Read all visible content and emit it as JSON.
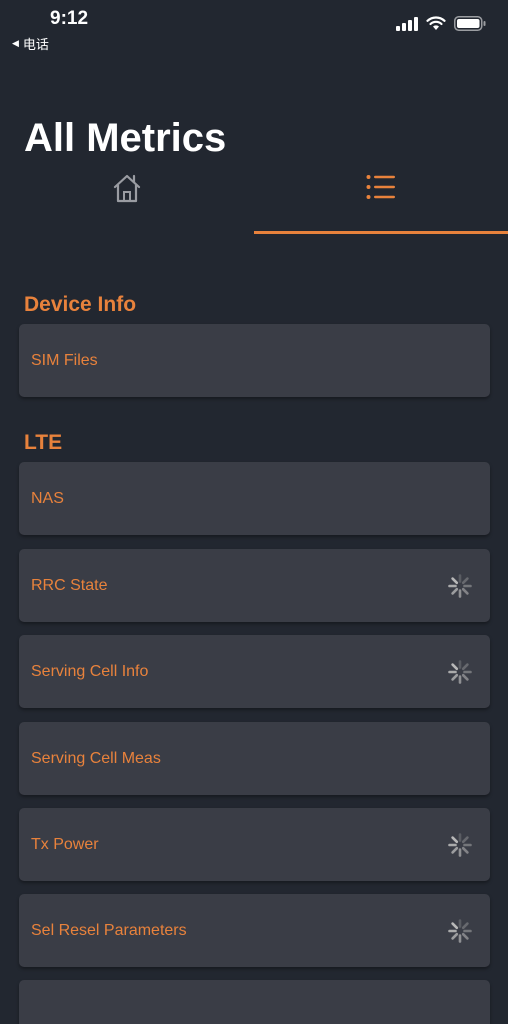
{
  "status_bar": {
    "time": "9:12",
    "back_app": "电话",
    "back_glyph": "◀",
    "icons": [
      "cellular-signal-icon",
      "wifi-icon",
      "battery-icon"
    ]
  },
  "header": {
    "title": "All Metrics"
  },
  "tabs": [
    {
      "icon": "home-icon",
      "selected": false
    },
    {
      "icon": "list-icon",
      "selected": true
    }
  ],
  "colors": {
    "accent": "#e8823c",
    "background": "#222730",
    "row_background": "#3a3d46",
    "spinner": "#b8b8b8"
  },
  "sections": [
    {
      "title": "Device Info",
      "items": [
        {
          "label": "SIM Files",
          "loading": false
        }
      ]
    },
    {
      "title": "LTE",
      "items": [
        {
          "label": "NAS",
          "loading": false
        },
        {
          "label": "RRC State",
          "loading": true
        },
        {
          "label": "Serving Cell Info",
          "loading": true
        },
        {
          "label": "Serving Cell Meas",
          "loading": false
        },
        {
          "label": "Tx Power",
          "loading": true
        },
        {
          "label": "Sel Resel Parameters",
          "loading": true
        }
      ]
    }
  ]
}
